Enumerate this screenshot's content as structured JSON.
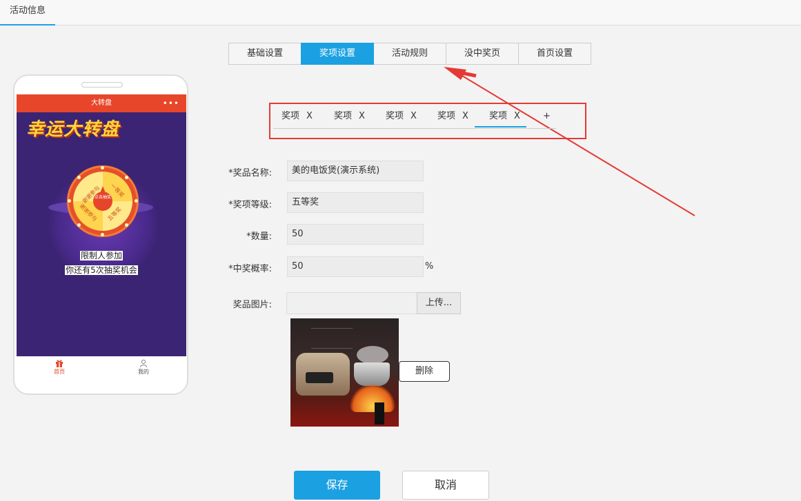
{
  "top_tab": "活动信息",
  "tabs": [
    {
      "label": "基础设置",
      "active": false
    },
    {
      "label": "奖项设置",
      "active": true
    },
    {
      "label": "活动规则",
      "active": false
    },
    {
      "label": "没中奖页",
      "active": false
    },
    {
      "label": "首页设置",
      "active": false
    }
  ],
  "prize_tabs": [
    {
      "label": "奖项",
      "close": "X"
    },
    {
      "label": "奖项",
      "close": "X"
    },
    {
      "label": "奖项",
      "close": "X"
    },
    {
      "label": "奖项",
      "close": "X"
    },
    {
      "label": "奖项",
      "close": "X",
      "active": true
    }
  ],
  "prize_add": "+",
  "form": {
    "name_label": "*奖品名称:",
    "name_value": "美的电饭煲(演示系统)",
    "level_label": "*奖项等级:",
    "level_value": "五等奖",
    "quantity_label": "*数量:",
    "quantity_value": "50",
    "probability_label": "*中奖概率:",
    "probability_value": "50",
    "probability_unit": "%",
    "image_label": "奖品图片:",
    "upload_label": "上传...",
    "delete_label": "删除"
  },
  "actions": {
    "save": "保存",
    "cancel": "取消"
  },
  "phone": {
    "header_title": "大转盘",
    "menu_dots": "•••",
    "banner": "幸运大转盘",
    "wheel_center": "点击抽奖",
    "wheel_segments": [
      "谢谢参与",
      "一等奖",
      "五等奖",
      "谢谢参与"
    ],
    "rule_line1": "限制人参加",
    "rule_line2": "你还有5次抽奖机会",
    "nav_home": "首页",
    "nav_mine": "我的"
  },
  "colors": {
    "accent": "#1ba1e2",
    "highlight_box": "#e53935",
    "phone_header": "#e8462a",
    "phone_bg": "#3b2473"
  }
}
